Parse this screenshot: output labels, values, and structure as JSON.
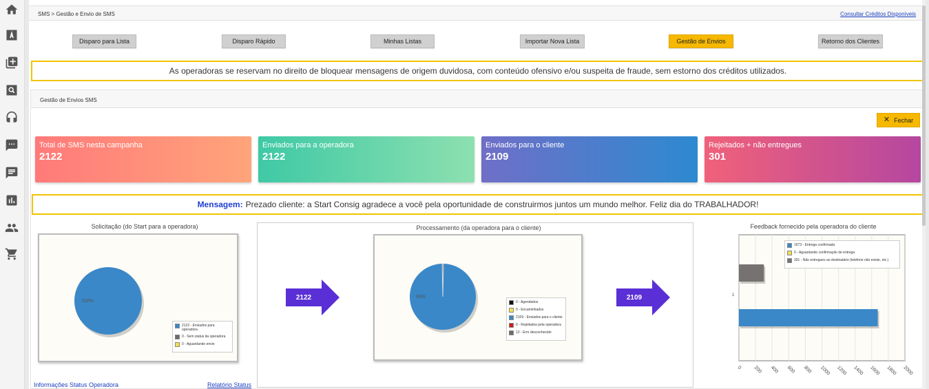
{
  "breadcrumb": "SMS > Gestão e Envio de SMS",
  "credits_link": "Consultar Créditos Disponíveis",
  "nav_buttons": [
    {
      "label": "Disparo para Lista"
    },
    {
      "label": "Disparo Rápido"
    },
    {
      "label": "Minhas Listas"
    },
    {
      "label": "Importar Nova Lista"
    },
    {
      "label": "Gestão de Envios",
      "active": true
    },
    {
      "label": "Retorno dos Clientes"
    }
  ],
  "warning_text": "As operadoras se reservam no direito de bloquear mensagens de origem duvidosa, com conteúdo ofensivo e/ou suspeita de fraude, sem estorno dos créditos utilizados.",
  "panel_title": "Gestão de Envios SMS",
  "close_label": "Fechar",
  "stats": [
    {
      "label": "Total de SMS nesta campanha",
      "value": "2122"
    },
    {
      "label": "Enviados para a operadora",
      "value": "2122"
    },
    {
      "label": "Enviados para o cliente",
      "value": "2109"
    },
    {
      "label": "Rejeitados + não entregues",
      "value": "301"
    }
  ],
  "message": {
    "label": "Mensagem:",
    "text": "Prezado cliente: a Start Consig agradece a você pela oportunidade de construirmos juntos um mundo melhor. Feliz dia do TRABALHADOR!"
  },
  "arrows": [
    "2122",
    "2109"
  ],
  "colors": {
    "accent": "#f6b800",
    "arrow": "#5a2fd6",
    "pie_blue": "#3a88c8"
  },
  "chart_data": [
    {
      "type": "pie",
      "title": "Solicitação (do Start para a operadora)",
      "slice_label": "100%",
      "slices": [
        {
          "name": "2122 - Enviados para operadora",
          "value": 2122,
          "color": "#3a88c8"
        },
        {
          "name": "0 - Sem status da operadora",
          "value": 0,
          "color": "#6b6b6b"
        },
        {
          "name": "0 - Aguardando envio",
          "value": 0,
          "color": "#f4e04a"
        }
      ]
    },
    {
      "type": "pie",
      "title": "Processamento (da operadora para o cliente)",
      "slice_label": "99%",
      "slices": [
        {
          "name": "0 - Agendados",
          "value": 0,
          "color": "#111111"
        },
        {
          "name": "0 - Encaminhados",
          "value": 0,
          "color": "#f4e04a"
        },
        {
          "name": "2109 - Enviados para o cliente",
          "value": 2109,
          "color": "#3a88c8"
        },
        {
          "name": "0 - Rejeitados pela operadora",
          "value": 0,
          "color": "#d11a1a"
        },
        {
          "name": "13 - Erro desconhecido",
          "value": 13,
          "color": "#6b6b6b"
        }
      ]
    },
    {
      "type": "bar",
      "orientation": "horizontal",
      "title": "Feedback fornecido pela operadora do cliente",
      "category_label": "1",
      "xlim": [
        0,
        2000
      ],
      "ticks": [
        "0",
        "200",
        "400",
        "600",
        "800",
        "1000",
        "1200",
        "1400",
        "1600",
        "1800",
        "2000"
      ],
      "series": [
        {
          "name": "1673 - Entrega confirmada",
          "value": 1673,
          "color": "#3a88c8"
        },
        {
          "name": "0 - Aguardando confirmação de entrega",
          "value": 0,
          "color": "#f4e04a"
        },
        {
          "name": "301 - Não entregues ao destinatário (telefone não existe, etc.)",
          "value": 301,
          "color": "#777272"
        }
      ]
    }
  ],
  "bottom_links": {
    "operator_info": "Informações Status Operadora",
    "status_report": "Relatório Status"
  }
}
